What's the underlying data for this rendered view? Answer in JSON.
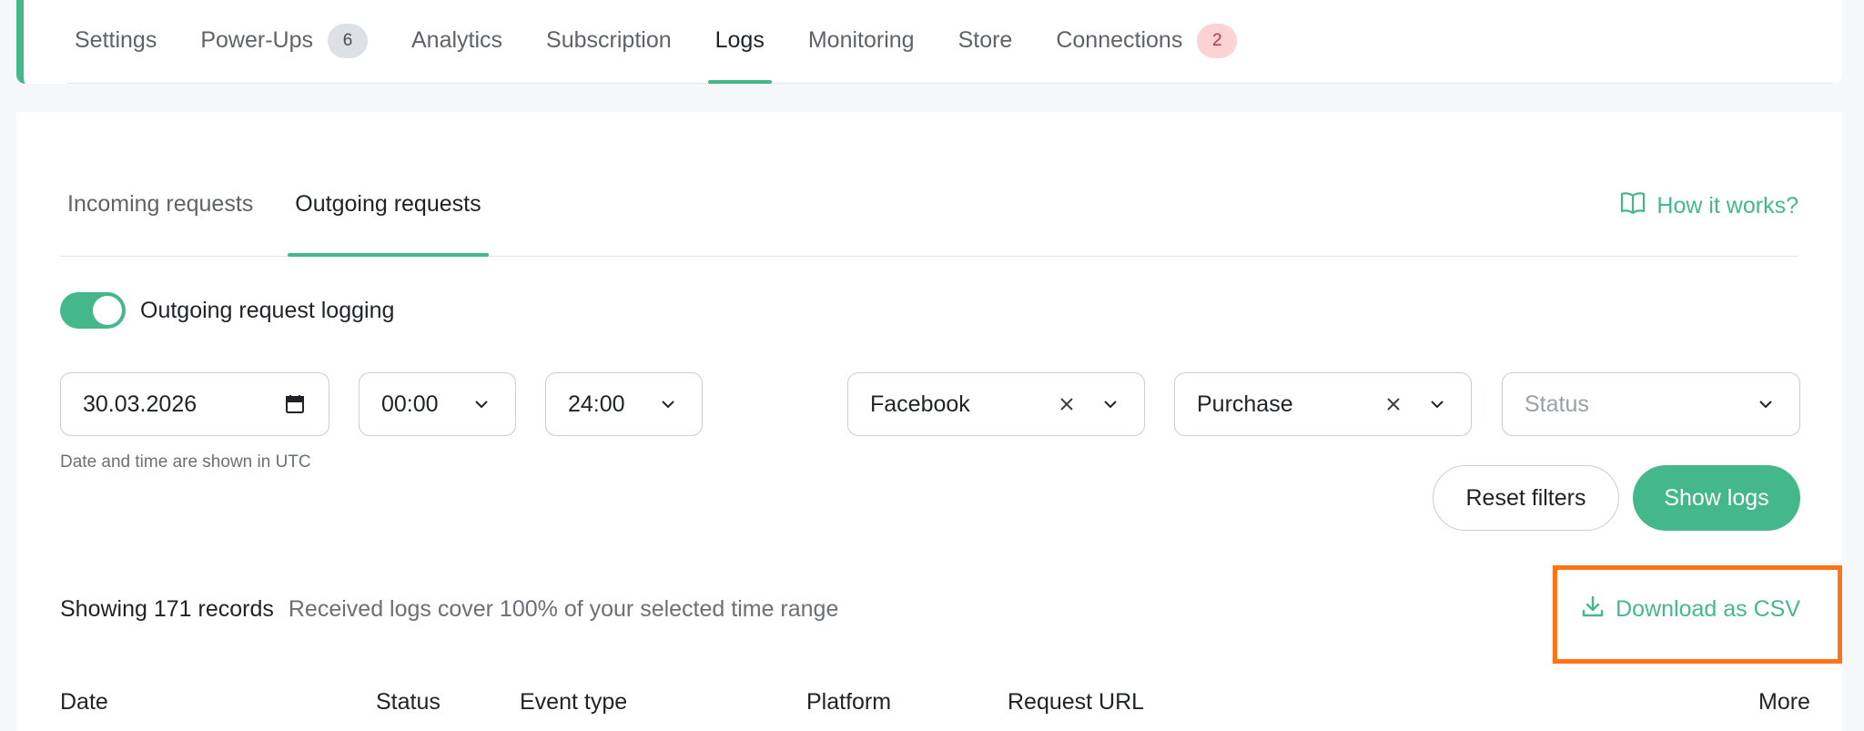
{
  "nav": {
    "tabs": [
      {
        "label": "Settings"
      },
      {
        "label": "Power-Ups",
        "badge": "6"
      },
      {
        "label": "Analytics"
      },
      {
        "label": "Subscription"
      },
      {
        "label": "Logs",
        "active": true
      },
      {
        "label": "Monitoring"
      },
      {
        "label": "Store"
      },
      {
        "label": "Connections",
        "badge": "2"
      }
    ]
  },
  "subtabs": {
    "incoming": "Incoming requests",
    "outgoing": "Outgoing requests"
  },
  "help": {
    "label": "How it works?",
    "icon": "book-icon"
  },
  "logging": {
    "label": "Outgoing request logging",
    "enabled": true
  },
  "filters": {
    "date": "30.03.2026",
    "time_from": "00:00",
    "time_to": "24:00",
    "platform": "Facebook",
    "event": "Purchase",
    "status_placeholder": "Status",
    "hint": "Date and time are shown in UTC"
  },
  "actions": {
    "reset": "Reset filters",
    "show": "Show logs"
  },
  "summary": {
    "count": "Showing 171 records",
    "coverage": "Received logs cover 100% of your selected time range"
  },
  "download": {
    "label": "Download as CSV",
    "icon": "download-icon"
  },
  "table": {
    "headers": [
      "Date",
      "Status",
      "Event type",
      "Platform",
      "Request URL",
      "More"
    ]
  },
  "colors": {
    "accent": "#45b88b",
    "highlight": "#ff7417",
    "badge_gray": "#dde0e5",
    "badge_red": "#fbd3d5"
  }
}
